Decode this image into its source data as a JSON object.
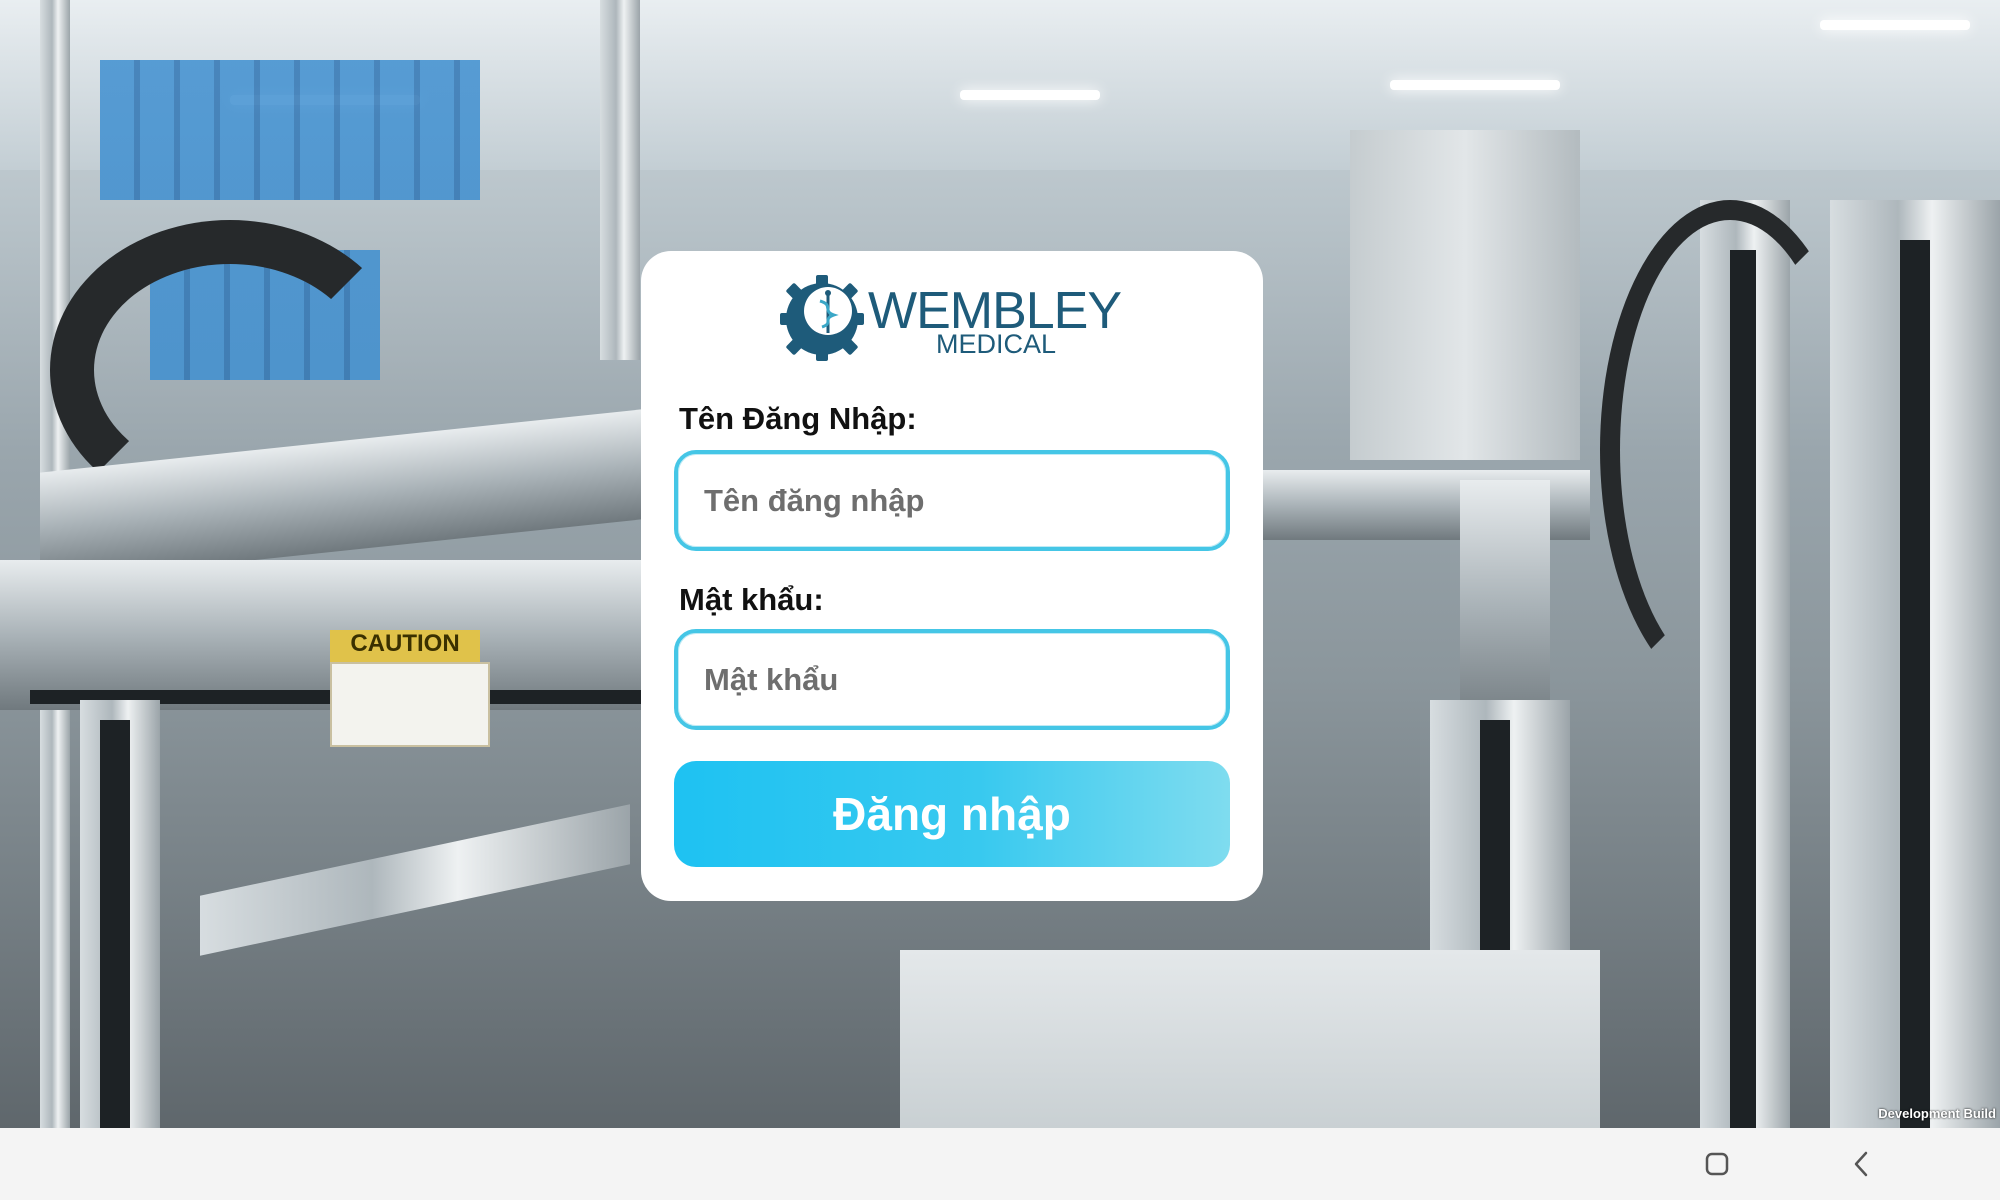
{
  "brand": {
    "name_line1": "WEMBLEY",
    "name_line2": "MEDICAL",
    "color": "#1e5b7a"
  },
  "login": {
    "username_label": "Tên Đăng Nhập:",
    "username_placeholder": "Tên đăng nhập",
    "password_label": "Mật khẩu:",
    "password_placeholder": "Mật khẩu",
    "submit_label": "Đăng nhập",
    "accent_color": "#45c6e6"
  },
  "background": {
    "caution_sign": "CAUTION"
  },
  "overlay": {
    "build_text": "Development Build"
  },
  "navbar": {
    "buttons": [
      {
        "icon": "recent-apps-icon"
      },
      {
        "icon": "back-icon"
      }
    ]
  }
}
